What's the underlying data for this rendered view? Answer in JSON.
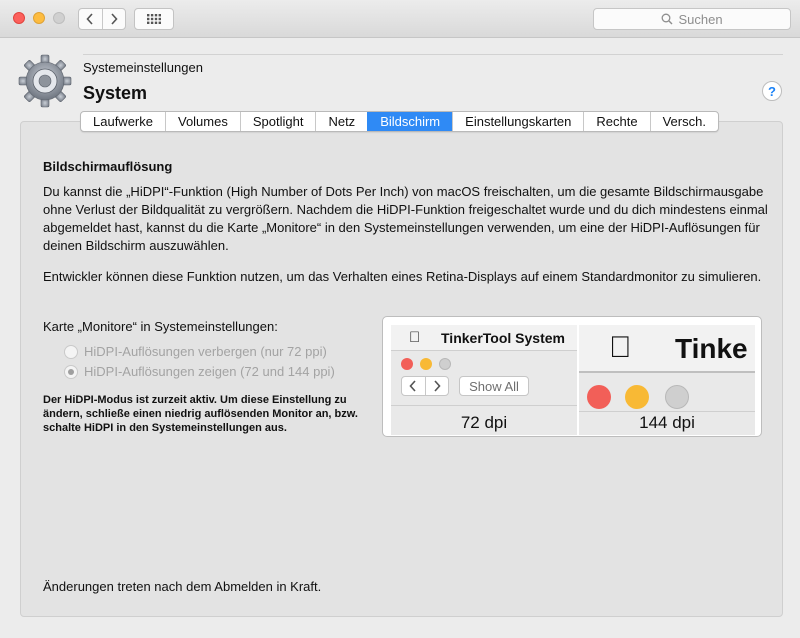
{
  "window": {
    "traffic_lights": [
      "close",
      "minimize",
      "zoom"
    ],
    "search_placeholder": "Suchen"
  },
  "header": {
    "supertitle": "Systemeinstellungen",
    "title": "System",
    "help_label": "?"
  },
  "tabs": [
    {
      "label": "Laufwerke",
      "active": false
    },
    {
      "label": "Volumes",
      "active": false
    },
    {
      "label": "Spotlight",
      "active": false
    },
    {
      "label": "Netz",
      "active": false
    },
    {
      "label": "Bildschirm",
      "active": true
    },
    {
      "label": "Einstellungskarten",
      "active": false
    },
    {
      "label": "Rechte",
      "active": false
    },
    {
      "label": "Versch.",
      "active": false
    }
  ],
  "content": {
    "section_title": "Bildschirmauflösung",
    "paragraph1": "Du kannst die „HiDPI“-Funktion (High Number of Dots Per Inch) von macOS freischalten, um die gesamte Bildschirmausgabe ohne Verlust der Bildqualität zu vergrößern. Nachdem die HiDPI-Funktion freigeschaltet wurde und du dich mindestens einmal abgemeldet hast, kannst du die Karte „Monitore“ in den Systemeinstellungen verwenden, um eine der HiDPI-Auflösungen für deinen Bildschirm auszuwählen.",
    "paragraph2": "Entwickler können diese Funktion nutzen, um das Verhalten eines Retina-Displays auf einem Standardmonitor zu simulieren.",
    "karte_label": "Karte „Monitore“ in Systemeinstellungen:",
    "radio_options": [
      {
        "label": "HiDPI-Auflösungen verbergen (nur 72 ppi)",
        "selected": false,
        "enabled": false
      },
      {
        "label": "HiDPI-Auflösungen zeigen (72 und 144 ppi)",
        "selected": true,
        "enabled": false
      }
    ],
    "note": "Der HiDPI-Modus ist zurzeit aktiv. Um diese Einstellung zu ändern, schließe einen niedrig auflösenden Monitor an, bzw. schalte HiDPI in den Systemeinstellungen aus.",
    "footer": "Änderungen treten nach dem Abmelden in Kraft."
  },
  "preview": {
    "left": {
      "app_name": "TinkerTool System",
      "show_all": "Show All",
      "dpi": "72 dpi"
    },
    "right": {
      "app_name": "Tinke",
      "dpi": "144 dpi"
    }
  },
  "colors": {
    "accent": "#2f8af5",
    "close": "#fc605c",
    "minimize": "#fdbc40"
  }
}
